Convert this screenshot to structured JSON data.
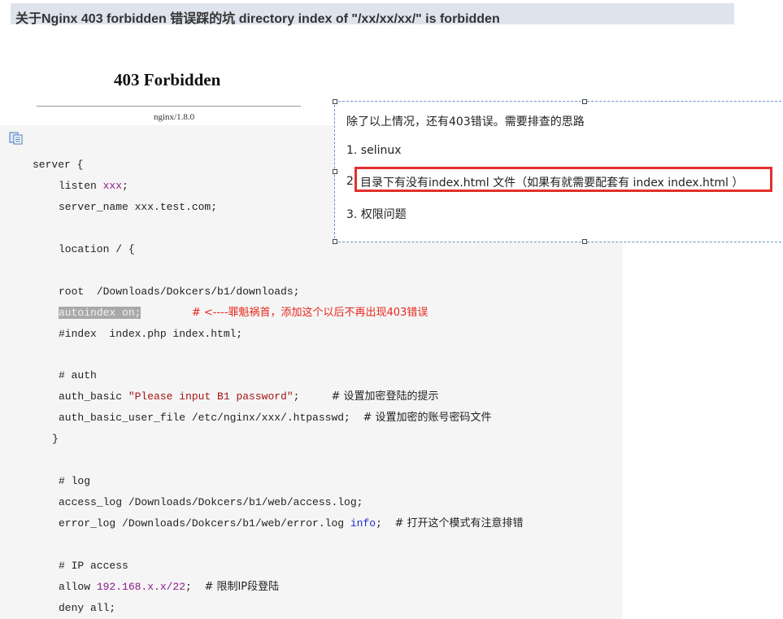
{
  "article": {
    "title": "关于Nginx 403 forbidden 错误踩的坑 directory index of \"/xx/xx/xx/\" is forbidden"
  },
  "screenshot_403": {
    "heading": "403 Forbidden",
    "server": "nginx/1.8.0"
  },
  "code_toolbar": {
    "copy_icon": "copy-code-icon"
  },
  "code": {
    "l1": "server {",
    "l2_a": "listen ",
    "l2_b": "xxx",
    "l2_c": ";",
    "l3": "server_name xxx.test.com;",
    "l4": "location / {",
    "l5": "root  /Downloads/Dokcers/b1/downloads;",
    "l6_a": "autoindex on;",
    "l6_b": "# <----罪魁祸首，添加这个以后不再出现403错误",
    "l7": "#index  index.php index.html;",
    "l8": "# auth",
    "l9_a": "auth_basic ",
    "l9_b": "\"Please input B1 password\"",
    "l9_c": ";     ",
    "l9_d": "# 设置加密登陆的提示",
    "l10_a": "auth_basic_user_file /etc/nginx/xxx/.htpasswd;  ",
    "l10_b": "# 设置加密的账号密码文件",
    "l11": "}",
    "l12": "# log",
    "l13": "access_log /Downloads/Dokcers/b1/web/access.log;",
    "l14_a": "error_log /Downloads/Dokcers/b1/web/error.log ",
    "l14_b": "info",
    "l14_c": ";  ",
    "l14_d": "# 打开这个模式有注意排错",
    "l15": "# IP access",
    "l16_a": "allow ",
    "l16_b": "192.168.x.x/22",
    "l16_c": ";  ",
    "l16_d": "# 限制IP段登陆",
    "l17": "deny all;"
  },
  "note": {
    "intro": "除了以上情况，还有403错误。需要排查的思路",
    "item1": "1. selinux",
    "item2_num": "2.",
    "item2_text": "目录下有没有index.html 文件（如果有就需要配套有 index  index.html  ）",
    "item3": "3. 权限问题"
  },
  "colors": {
    "highlight_frame": "#e52e2e",
    "title_bar": "#dfe3ec",
    "code_bg": "#f5f5f5"
  }
}
